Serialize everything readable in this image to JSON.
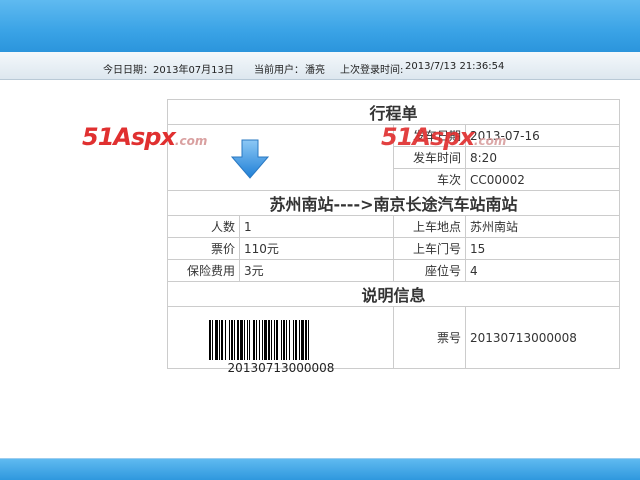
{
  "header": {
    "date_label": "今日日期：",
    "date_value": "2013年07月13日",
    "user_label": "当前用户：",
    "user_value": "潘亮",
    "last_login_label": "上次登录时间:",
    "last_login_value": "2013/7/13 21:36:54"
  },
  "ticket": {
    "title": "行程单",
    "depart_date_label": "发车日期",
    "depart_date_value": "2013-07-16",
    "depart_time_label": "发车时间",
    "depart_time_value": "8:20",
    "train_no_label": "车次",
    "train_no_value": "CC00002",
    "route": "苏州南站---->南京长途汽车站南站",
    "people_label": "人数",
    "people_value": "1",
    "boarding_place_label": "上车地点",
    "boarding_place_value": "苏州南站",
    "price_label": "票价",
    "price_value": "110元",
    "gate_label": "上车门号",
    "gate_value": "15",
    "insurance_label": "保险费用",
    "insurance_value": "3元",
    "seat_label": "座位号",
    "seat_value": "4",
    "notes_title": "说明信息",
    "ticket_no_label": "票号",
    "ticket_no_value": "20130713000008",
    "barcode_text": "20130713000008"
  },
  "watermark": {
    "text_main": "51Aspx",
    "text_suffix": ".com"
  },
  "icons": {
    "arrow": "down-arrow-icon",
    "barcode": "barcode-icon"
  },
  "colors": {
    "band": "#3aa3e6",
    "logo_red": "#e03030",
    "arrow_blue": "#2d8ee0"
  }
}
